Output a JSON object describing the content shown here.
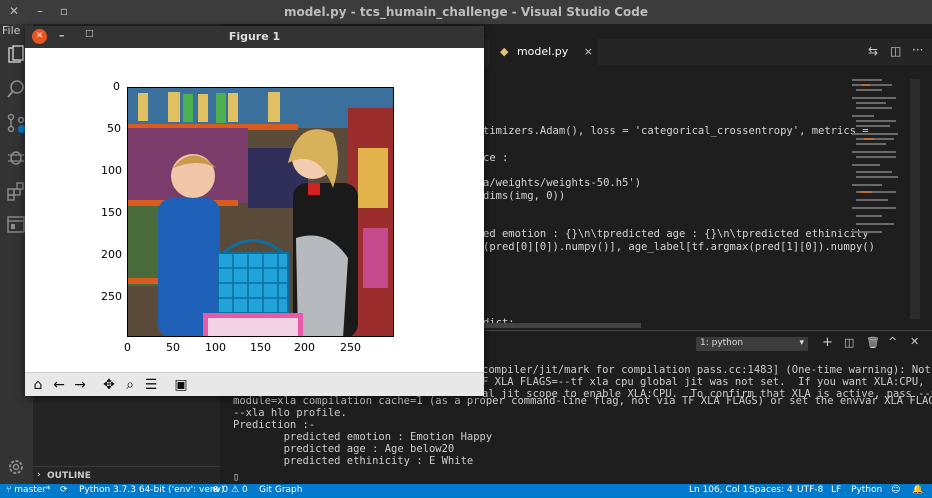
{
  "window": {
    "title": "model.py - tcs_humain_challenge - Visual Studio Code"
  },
  "menu": {
    "file": "File"
  },
  "editor": {
    "tab_label": "model.py",
    "lines": [
      "timizers.Adam(), loss = 'categorical_crossentropy', metrics =",
      "ce :",
      "a/weights/weights-50.h5')",
      "dims(img, 0))",
      "ed emotion : {}\\n\\tpredicted age : {}\\n\\tpredicted ethinicity",
      "(pred[0][0]).numpy()], age_label[tf.argmax(pred[1][0]).numpy()",
      "dict:"
    ]
  },
  "panel": {
    "terminal_select": "1: python",
    "lines": [
      "compiler/jit/mark for compilation pass.cc:1483] (One-time warning): Not",
      "F XLA FLAGS=--tf xla cpu global jit was not set.  If you want XLA:CPU,",
      "al jit scope to enable XLA:CPU.  To confirm that XLA is active, pass --v",
      "module=xla compilation cache=1 (as a proper command-line flag, not via TF XLA FLAGS) or set the envvar XLA FLAGS=",
      "--xla hlo profile.",
      "Prediction :-",
      "        predicted emotion : Emotion Happy",
      "        predicted age : Age below20",
      "        predicted ethinicity : E White"
    ],
    "cursor": "▯"
  },
  "sidebar": {
    "outline": "OUTLINE"
  },
  "status": {
    "branch": "master*",
    "python": "Python 3.7.3 64-bit ('env': venv)",
    "errors": "0",
    "warnings": "0",
    "git_graph": "Git Graph",
    "position": "Ln 106, Col 1",
    "spaces": "Spaces: 4",
    "encoding": "UTF-8",
    "eol": "LF",
    "language": "Python"
  },
  "figure": {
    "title": "Figure 1",
    "x_ticks": [
      "0",
      "50",
      "100",
      "150",
      "200",
      "250"
    ],
    "y_ticks": [
      "0",
      "50",
      "100",
      "150",
      "200",
      "250"
    ]
  },
  "colors": {
    "accent": "#007acc",
    "close": "#e95420"
  }
}
